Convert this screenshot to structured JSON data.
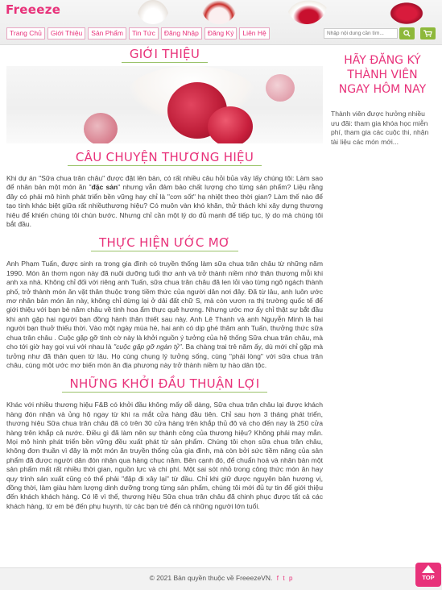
{
  "brand": {
    "logo": "Freeeze",
    "accent_color": "#e8327a",
    "green_color": "#8db83a"
  },
  "nav": {
    "items": [
      {
        "label": "Trang Chủ"
      },
      {
        "label": "Giới Thiệu"
      },
      {
        "label": "Sản Phẩm"
      },
      {
        "label": "Tin Tức"
      },
      {
        "label": "Đăng Nhập"
      },
      {
        "label": "Đăng Ký"
      },
      {
        "label": "Liên Hệ"
      }
    ]
  },
  "search": {
    "placeholder": "Nhập nội dung cần tìm...",
    "button_icon": "search-icon",
    "cart_icon": "cart-icon"
  },
  "main": {
    "title": "GIỚI THIỆU",
    "section1": {
      "title": "CÂU CHUYỆN THƯƠNG HIỆU",
      "p1": "Khi dự án \"Sữa chua trân châu\" được đặt lên bàn, có rất nhiều câu hỏi bủa vây lấy chúng tôi: Làm sao để nhân bản một món ăn \"",
      "p1_bold": "đặc sản",
      "p2": "\" nhưng vẫn đảm bảo chất lượng cho từng sản phẩm? Liệu rằng đây có phải mô hình phát triển bền vững hay chỉ là \"cơn sốt\" hạ nhiệt theo thời gian? Làm thế nào để tạo tính khác biệt giữa rất nhiềuthương hiệu? Có muôn vàn khó khăn, thử thách khi xây dựng thương hiệu để khiến chúng tôi chùn bước. Nhưng chỉ cần một lý do đủ mạnh để tiếp tục, lý do mà chúng tôi bắt đầu."
    },
    "section2": {
      "title": "THỰC HIỆN ƯỚC MƠ",
      "p1": "Anh Phạm Tuấn, được sinh ra trong gia đình có truyền thống làm sữa chua trân châu từ những năm 1990. Món ăn thơm ngon này đã nuôi dưỡng tuổi thơ anh và trở thành niềm nhớ thân thương mỗi khi anh xa nhà. Không chỉ đối với riêng anh Tuấn, sữa chua trân châu đã len lỏi vào từng ngõ ngách thành phố, trở thành món ăn vặt thân thuộc trong tiềm thức của người dân nơi đây. Đã từ lâu, anh luôn ước mơ nhân bản món ăn này, không chỉ dừng lại ở dải đất chữ S, mà còn vươn ra thị trường quốc tế để giới thiệu với bạn bè năm châu về tinh hoa ẩm thực quê hương. Nhưng ước mơ ấy chỉ thật sự bắt đầu khi anh gặp hai người bạn đồng hành thân thiết sau này. Anh Lê Thanh và anh Nguyễn Minh là hai người bạn thuở thiếu thời. Vào một ngày mùa hè, hai anh có dịp ghé thăm anh Tuấn, thưởng thức sữa chua trân châu . Cuộc gặp gỡ tình cờ này là khởi nguồn ý tưởng của hệ thống Sữa chua trân châu, mà cho tới giờ hay gọi vui với nhau là ",
      "p1_italic": "\"cuộc gặp gỡ ngàn tỷ\"",
      "p2": ". Ba chàng trai trẻ năm ấy, dù mới chỉ gặp mà tưởng như đã thân quen từ lâu. Họ cùng chung lý tưởng sống, cùng \"phải lòng\" với sữa chua trân châu, cùng một ước mơ biến món ăn địa phương này trở thành niềm tự hào dân tộc."
    },
    "section3": {
      "title": "NHỮNG KHỞI ĐẦU THUẬN LỢI",
      "p1": "Khác với nhiều thương hiệu F&B có khởi đầu không mấy dễ dàng, Sữa chua trân châu lại được khách hàng đón nhận và ủng hộ ngay từ khi ra mắt cửa hàng đầu tiên. Chỉ sau hơn 3 tháng phát triển, thương hiệu Sữa chua trân châu đã có trên 30 cửa hàng trên khắp thủ đô và cho đến nay là 250 cửa hàng trên khắp cả nước. Điều gì đã làm nên sự thành công của thương hiệu? Không phải may mắn. Mọi mô hình phát triển bền vững đều xuất phát từ sản phẩm. Chúng tôi chọn sữa chua trân châu, không đơn thuần vì đây là một món ăn truyền thống của gia đình, mà còn bởi sức tiềm năng của sản phẩm đã được người dân đón nhận qua hàng chục năm. Bên cạnh đó, để chuẩn hoá và nhân bản một sản phẩm mất rất nhiều thời gian, nguồn lực và chi phí. Một sai sót nhỏ trong công thức món ăn hay quy trình sản xuất cũng có thể phải \"đập đi xây lại\" từ đầu. Chỉ khi giữ được nguyên bản hương vị, đồng thời, làm giàu hàm lượng dinh dưỡng trong từng sản phẩm, chúng tôi mới đủ tự tin để giới thiệu đến khách khách hàng. Có lẽ vì thế, thương hiệu Sữa chua trân châu đã chinh phục được tất cả các khách hàng, từ em bé đến phụ huynh, từ các bạn trẻ đến cả những người lớn tuổi."
    }
  },
  "sidebar": {
    "title": "HÃY ĐĂNG KÝ THÀNH VIÊN NGAY HÔM NAY",
    "text": "Thành viên được hưởng nhiều ưu đãi: tham gia khóa học miễn phí, tham gia các cuộc thi, nhận tài liệu các món mới..."
  },
  "footer": {
    "text": "© 2021 Bản quyền thuộc về FreeezeVN.",
    "social": [
      "f",
      "t",
      "p"
    ]
  },
  "top_button": {
    "label": "TOP"
  }
}
